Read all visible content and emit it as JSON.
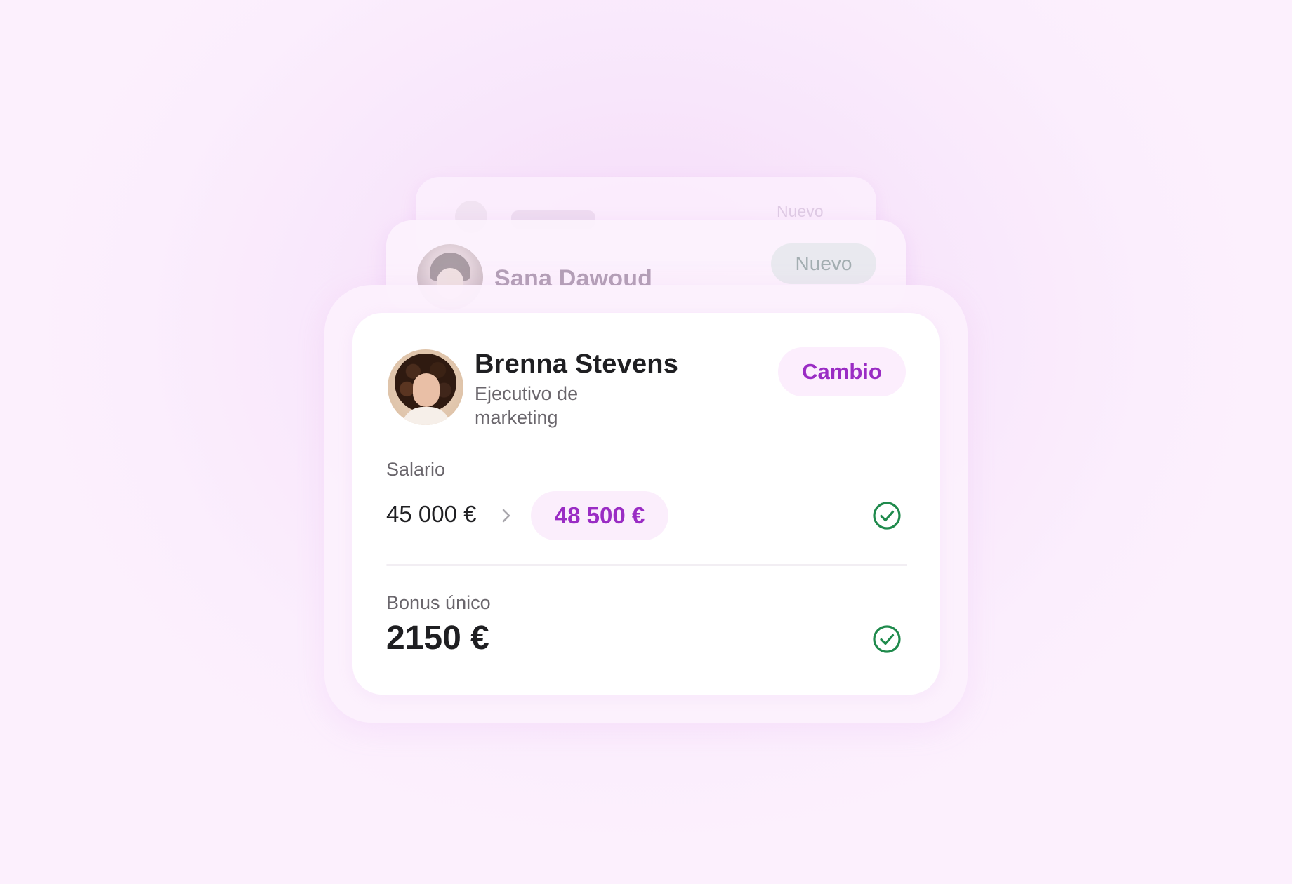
{
  "background_cards": {
    "back": {
      "badge": "Nuevo"
    },
    "middle": {
      "name": "Sana Dawoud",
      "badge": "Nuevo"
    }
  },
  "card": {
    "name": "Brenna Stevens",
    "role": "Ejecutivo de marketing",
    "badge": "Cambio",
    "salary": {
      "label": "Salario",
      "old_value": "45 000 €",
      "new_value": "48 500 €",
      "status_icon": "check-circle-icon"
    },
    "bonus": {
      "label": "Bonus único",
      "value": "2150 €",
      "status_icon": "check-circle-icon"
    }
  },
  "colors": {
    "accent": "#9a2cc4",
    "accent_bg": "#fbeefc",
    "check": "#1f8a4c",
    "background": "#f8e6fb"
  }
}
